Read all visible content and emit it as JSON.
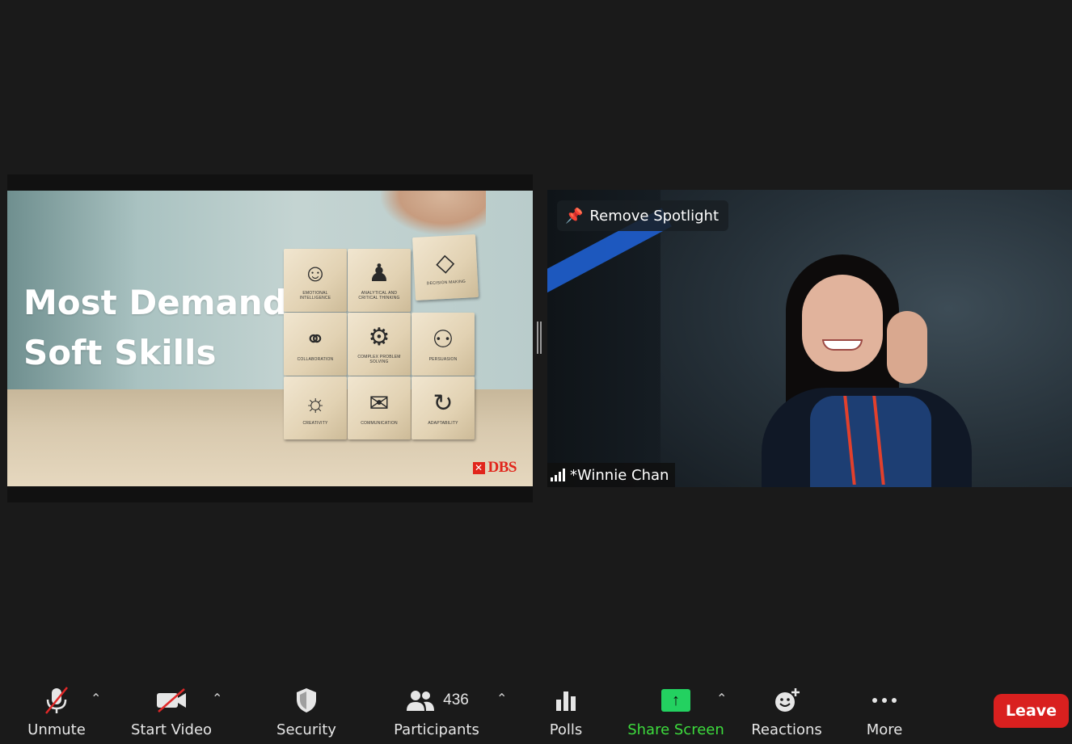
{
  "share": {
    "slide_title_line1": "Most Demand",
    "slide_title_line2": "Soft Skills",
    "logo_text": "DBS",
    "blocks": [
      {
        "icon": "head-heart-icon",
        "glyph": "☺",
        "label": "EMOTIONAL INTELLIGENCE"
      },
      {
        "icon": "chess-pawn-icon",
        "glyph": "♟",
        "label": "ANALYTICAL AND CRITICAL THINKING"
      },
      {
        "icon": "diamond-icon",
        "glyph": "◇",
        "label": "DECISION MAKING"
      },
      {
        "icon": "handshake-icon",
        "glyph": "⚭",
        "label": "COLLABORATION"
      },
      {
        "icon": "gears-icon",
        "glyph": "⚙",
        "label": "COMPLEX PROBLEM SOLVING"
      },
      {
        "icon": "people-icon",
        "glyph": "⚇",
        "label": "PERSUASION"
      },
      {
        "icon": "lightbulb-icon",
        "glyph": "☼",
        "label": "CREATIVITY"
      },
      {
        "icon": "speech-bubbles-icon",
        "glyph": "✉",
        "label": "COMMUNICATION"
      },
      {
        "icon": "head-cycle-icon",
        "glyph": "↻",
        "label": "ADAPTABILITY"
      }
    ]
  },
  "video": {
    "spotlight_label": "Remove Spotlight",
    "participant_name": "*Winnie Chan"
  },
  "toolbar": {
    "unmute_label": "Unmute",
    "start_video_label": "Start Video",
    "security_label": "Security",
    "participants_label": "Participants",
    "participants_count": "436",
    "polls_label": "Polls",
    "share_screen_label": "Share Screen",
    "reactions_label": "Reactions",
    "more_label": "More",
    "leave_label": "Leave"
  },
  "colors": {
    "background": "#1a1a1a",
    "share_screen_green": "#23d160",
    "leave_red": "#d9201f",
    "dbs_red": "#e1251b"
  }
}
